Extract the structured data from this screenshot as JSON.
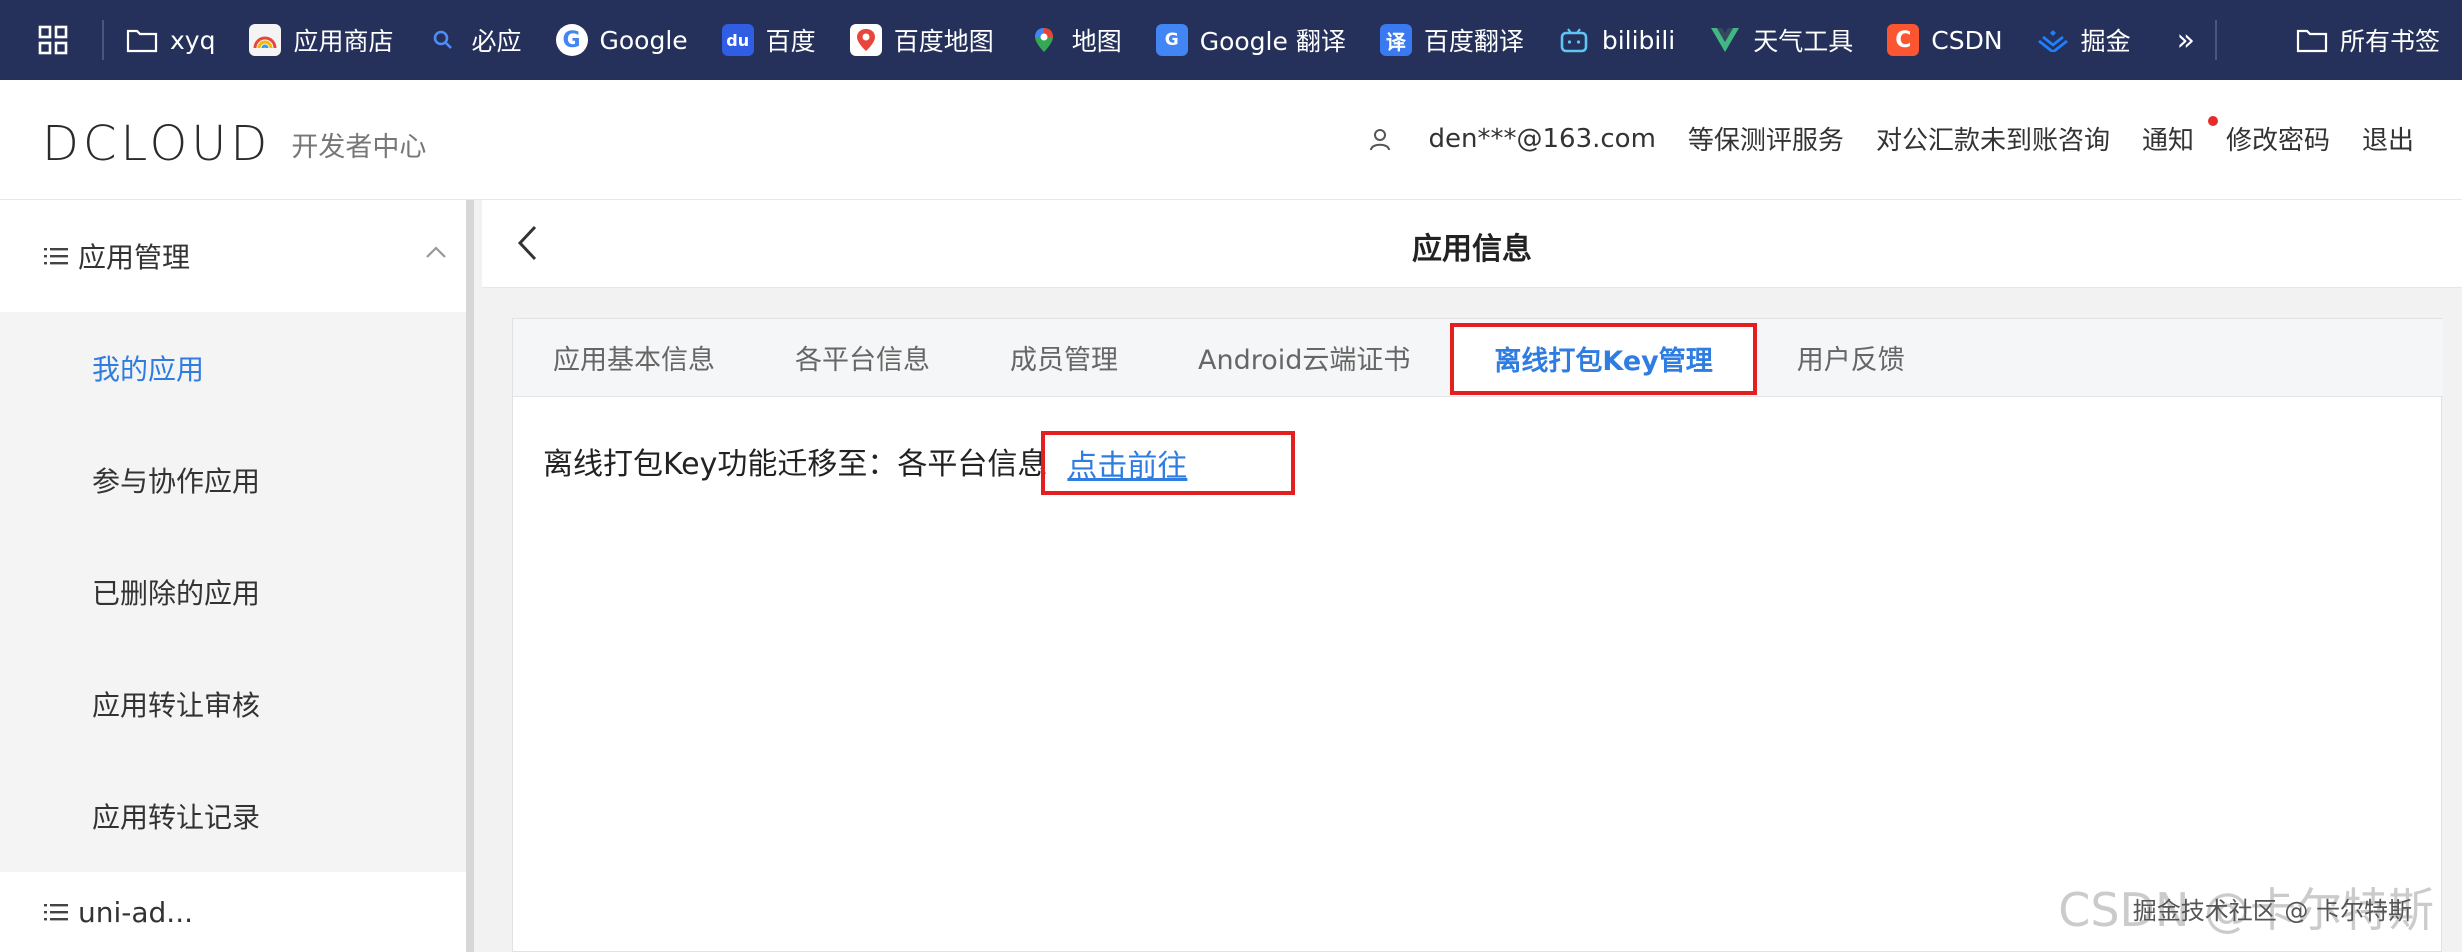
{
  "bookmarks": {
    "items": [
      {
        "label": "xyq",
        "icon": "folder-icon"
      },
      {
        "label": "应用商店",
        "icon": "app-store-icon"
      },
      {
        "label": "必应",
        "icon": "bing-search-icon"
      },
      {
        "label": "Google",
        "icon": "google-icon"
      },
      {
        "label": "百度",
        "icon": "baidu-icon"
      },
      {
        "label": "百度地图",
        "icon": "baidu-map-icon"
      },
      {
        "label": "地图",
        "icon": "map-pin-icon"
      },
      {
        "label": "Google 翻译",
        "icon": "google-translate-icon"
      },
      {
        "label": "百度翻译",
        "icon": "baidu-translate-icon"
      },
      {
        "label": "bilibili",
        "icon": "bilibili-icon"
      },
      {
        "label": "天气工具",
        "icon": "vue-icon"
      },
      {
        "label": "CSDN",
        "icon": "csdn-icon"
      },
      {
        "label": "掘金",
        "icon": "juejin-icon"
      }
    ],
    "more": "»",
    "all_bookmarks": "所有书签"
  },
  "header": {
    "logo": "DCLOUD",
    "subtitle": "开发者中心",
    "user": "den***@163.com",
    "nav": [
      "等保测评服务",
      "对公汇款未到账咨询",
      "通知",
      "修改密码",
      "退出"
    ]
  },
  "sidebar": {
    "group": "应用管理",
    "items": [
      {
        "label": "我的应用",
        "active": true
      },
      {
        "label": "参与协作应用"
      },
      {
        "label": "已删除的应用"
      },
      {
        "label": "应用转让审核"
      },
      {
        "label": "应用转让记录"
      }
    ],
    "next_group": "uni-ad..."
  },
  "main": {
    "title": "应用信息",
    "tabs": [
      "应用基本信息",
      "各平台信息",
      "成员管理",
      "Android云端证书",
      "离线打包Key管理",
      "用户反馈"
    ],
    "active_tab": 4,
    "message": "离线打包Key功能迁移至：各平台信息",
    "link": "点击前往"
  },
  "watermark": {
    "large": "CSDN @卡尔特斯",
    "small": "掘金技术社区 @ 卡尔特斯"
  },
  "colors": {
    "bookmark_bar": "#25315a",
    "accent": "#2f7de1",
    "highlight_border": "#e41f1f"
  }
}
